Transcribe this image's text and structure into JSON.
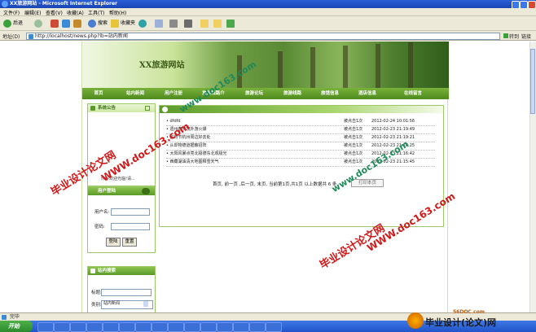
{
  "window": {
    "title": "XX旅游网站 - Microsoft Internet Explorer"
  },
  "menu": [
    "文件(F)",
    "编辑(E)",
    "查看(V)",
    "收藏(A)",
    "工具(T)",
    "帮助(H)"
  ],
  "toolbar": {
    "back": "后退",
    "search": "搜索",
    "favorites": "收藏夹"
  },
  "address": {
    "label": "地址(D)",
    "url": "http://localhost/news.php?lb=站内新闻",
    "go": "转到",
    "links": "链接"
  },
  "site": {
    "logo": "XX旅游网站",
    "nav": [
      "首页",
      "站内新闻",
      "用户注册",
      "旅游线路介",
      "旅游论坛",
      "旅游线路",
      "旅馆信息",
      "酒店信息",
      "在线留言"
    ]
  },
  "sidebar": {
    "notice_title": "系统公告",
    "notice_text": "你好欢迎光临!请...",
    "login_title": "用户登陆",
    "username_label": "用户名:",
    "password_label": "密码:",
    "login_button": "登陆",
    "reset_button": "重置",
    "search_title": "站内搜索",
    "keyword_label": "标题:",
    "category_label": "类别:",
    "category_value": "站内新闻"
  },
  "news": {
    "rows": [
      {
        "title": "dfdfd",
        "hits": "被点击1次",
        "date": "2012-02-24 10:01:56"
      },
      {
        "title": "遗州春节境外游火爆",
        "hits": "被点击1次",
        "date": "2012-02-23 21:19:49"
      },
      {
        "title": "完胃节杭州周边好去处",
        "hits": "被点击1次",
        "date": "2012-02-23 21:19:21"
      },
      {
        "title": "从却物德道据蔽招阵",
        "hits": "被点击1次",
        "date": "2012-02-23 21:18:25"
      },
      {
        "title": "大阳风暴点亮北极德东北观极光",
        "hits": "被点击1次",
        "date": "2012-02-23 21:16:42"
      },
      {
        "title": "西藏湖油清大地图释雪天气",
        "hits": "被点击1次",
        "date": "2012-02-23 21:15:45"
      }
    ],
    "pager": "首页, 前一页 ,后一页, 末页, 当前第1页,共1页 以上数据共 6 条,",
    "print_button": "打印本页"
  },
  "status": {
    "text": "完毕"
  },
  "taskbar": {
    "start": "开始",
    "items": [
      "",
      "",
      "",
      "",
      "",
      "",
      "",
      "",
      "",
      "",
      "",
      "",
      "",
      "",
      ""
    ]
  },
  "watermarks": {
    "site1": "毕业设计论文网",
    "url1": "WWW.doc163.com",
    "site2": "毕业设计论文网",
    "url2": "WWW.doc163.com",
    "url3": "www.doc163.com",
    "corner": "毕业设计(论文)网",
    "corner_url": "56DOC.com"
  },
  "colors": {
    "accent": "#5b9a28",
    "watermark": "#d21818"
  }
}
